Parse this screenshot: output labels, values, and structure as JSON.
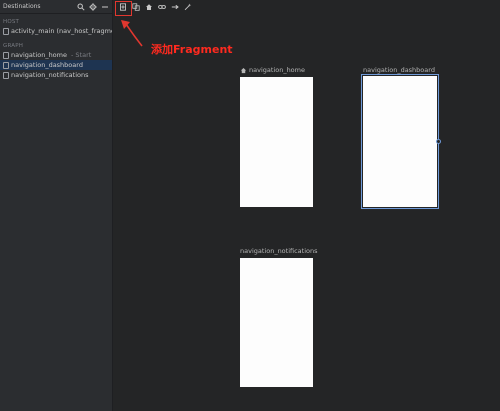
{
  "panel": {
    "title": "Destinations",
    "header_icons": [
      "search-icon",
      "gear-icon",
      "minus-icon"
    ],
    "host_label": "HOST",
    "host_item": "activity_main (nav_host_fragmer",
    "graph_label": "GRAPH",
    "graph_items": [
      {
        "label": "navigation_home",
        "meta": "- Start"
      },
      {
        "label": "navigation_dashboard",
        "meta": ""
      },
      {
        "label": "navigation_notifications",
        "meta": ""
      }
    ]
  },
  "toolbar": {
    "icons": [
      "new-destination-icon",
      "nested-graph-icon",
      "home-icon",
      "link-icon",
      "arrow-right-icon",
      "auto-arrange-icon"
    ]
  },
  "annotation": {
    "text": "添加Fragment",
    "color": "#e1372f"
  },
  "canvas": {
    "destinations": [
      {
        "label": "navigation_home",
        "is_start": true
      },
      {
        "label": "navigation_dashboard",
        "is_start": false
      },
      {
        "label": "navigation_notifications",
        "is_start": false
      }
    ]
  },
  "colors": {
    "background": "#242526",
    "panel": "#2b2d30",
    "selection": "#1e3451",
    "accent": "#6f9ad8"
  }
}
